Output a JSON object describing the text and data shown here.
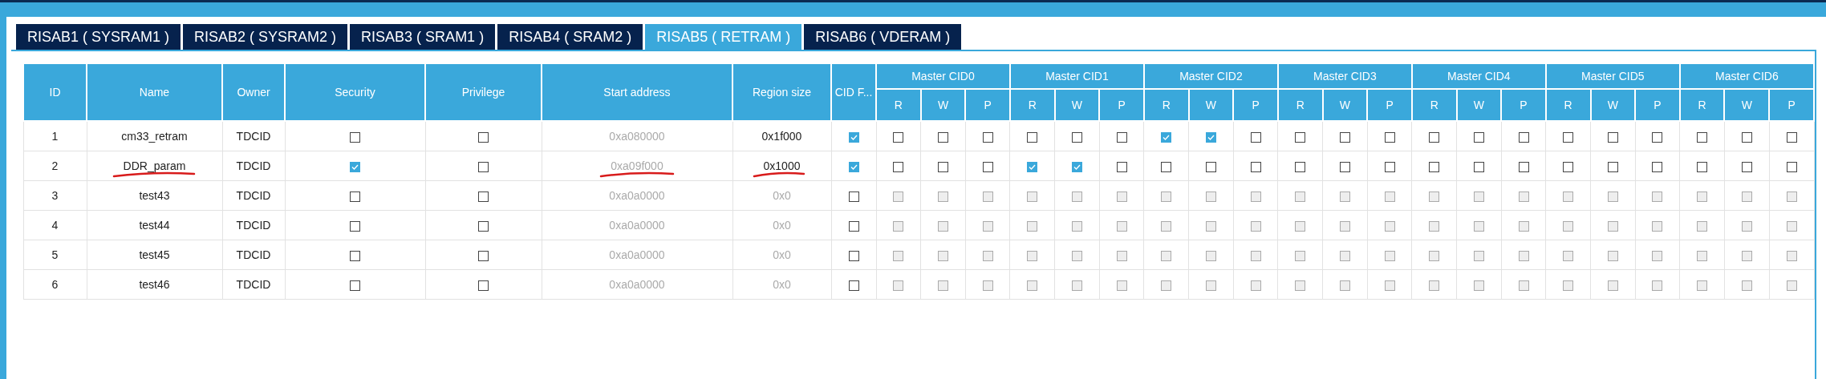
{
  "tabs": [
    {
      "label": "RISAB1 ( SYSRAM1 )",
      "selected": false
    },
    {
      "label": "RISAB2 ( SYSRAM2 )",
      "selected": false
    },
    {
      "label": "RISAB3 ( SRAM1 )",
      "selected": false
    },
    {
      "label": "RISAB4 ( SRAM2 )",
      "selected": false
    },
    {
      "label": "RISAB5 ( RETRAM )",
      "selected": true
    },
    {
      "label": "RISAB6 ( VDERAM )",
      "selected": false
    }
  ],
  "table": {
    "columns": [
      "ID",
      "Name",
      "Owner",
      "Security",
      "Privilege",
      "Start address",
      "Region size",
      "CID F..."
    ],
    "master_groups": [
      {
        "label": "Master CID0",
        "subcolumns": [
          "R",
          "W",
          "P"
        ]
      },
      {
        "label": "Master CID1",
        "subcolumns": [
          "R",
          "W",
          "P"
        ]
      },
      {
        "label": "Master CID2",
        "subcolumns": [
          "R",
          "W",
          "P"
        ]
      },
      {
        "label": "Master CID3",
        "subcolumns": [
          "R",
          "W",
          "P"
        ]
      },
      {
        "label": "Master CID4",
        "subcolumns": [
          "R",
          "W",
          "P"
        ]
      },
      {
        "label": "Master CID5",
        "subcolumns": [
          "R",
          "W",
          "P"
        ]
      },
      {
        "label": "Master CID6",
        "subcolumns": [
          "R",
          "W",
          "P"
        ]
      }
    ],
    "rows": [
      {
        "id": "1",
        "name": "cm33_retram",
        "owner": "TDCID",
        "security": false,
        "privilege": false,
        "start_address": "0xa080000",
        "region_size": "0x1f000",
        "cid_filter": true,
        "disabled": false,
        "annotated": false,
        "permissions": [
          false,
          false,
          false,
          false,
          false,
          false,
          true,
          true,
          false,
          false,
          false,
          false,
          false,
          false,
          false,
          false,
          false,
          false,
          false,
          false,
          false
        ]
      },
      {
        "id": "2",
        "name": "DDR_param",
        "owner": "TDCID",
        "security": true,
        "privilege": false,
        "start_address": "0xa09f000",
        "region_size": "0x1000",
        "cid_filter": true,
        "disabled": false,
        "annotated": true,
        "permissions": [
          false,
          false,
          false,
          true,
          true,
          false,
          false,
          false,
          false,
          false,
          false,
          false,
          false,
          false,
          false,
          false,
          false,
          false,
          false,
          false,
          false
        ]
      },
      {
        "id": "3",
        "name": "test43",
        "owner": "TDCID",
        "security": false,
        "privilege": false,
        "start_address": "0xa0a0000",
        "region_size": "0x0",
        "cid_filter": false,
        "disabled": true,
        "annotated": false,
        "permissions": [
          false,
          false,
          false,
          false,
          false,
          false,
          false,
          false,
          false,
          false,
          false,
          false,
          false,
          false,
          false,
          false,
          false,
          false,
          false,
          false,
          false
        ]
      },
      {
        "id": "4",
        "name": "test44",
        "owner": "TDCID",
        "security": false,
        "privilege": false,
        "start_address": "0xa0a0000",
        "region_size": "0x0",
        "cid_filter": false,
        "disabled": true,
        "annotated": false,
        "permissions": [
          false,
          false,
          false,
          false,
          false,
          false,
          false,
          false,
          false,
          false,
          false,
          false,
          false,
          false,
          false,
          false,
          false,
          false,
          false,
          false,
          false
        ]
      },
      {
        "id": "5",
        "name": "test45",
        "owner": "TDCID",
        "security": false,
        "privilege": false,
        "start_address": "0xa0a0000",
        "region_size": "0x0",
        "cid_filter": false,
        "disabled": true,
        "annotated": false,
        "permissions": [
          false,
          false,
          false,
          false,
          false,
          false,
          false,
          false,
          false,
          false,
          false,
          false,
          false,
          false,
          false,
          false,
          false,
          false,
          false,
          false,
          false
        ]
      },
      {
        "id": "6",
        "name": "test46",
        "owner": "TDCID",
        "security": false,
        "privilege": false,
        "start_address": "0xa0a0000",
        "region_size": "0x0",
        "cid_filter": false,
        "disabled": true,
        "annotated": false,
        "permissions": [
          false,
          false,
          false,
          false,
          false,
          false,
          false,
          false,
          false,
          false,
          false,
          false,
          false,
          false,
          false,
          false,
          false,
          false,
          false,
          false,
          false
        ]
      }
    ]
  }
}
